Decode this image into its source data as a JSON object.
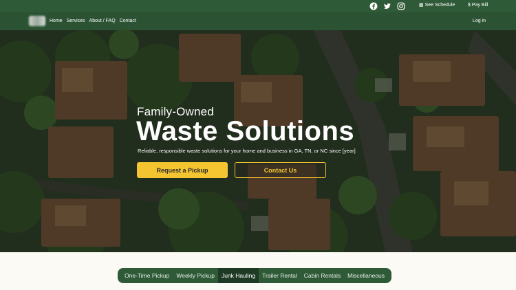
{
  "topbar": {
    "social": [
      "facebook-icon",
      "twitter-icon",
      "instagram-icon"
    ],
    "see_schedule": "See Schedule",
    "pay_bill": "Pay Bill"
  },
  "nav": {
    "items": [
      "Home",
      "Services",
      "About / FAQ",
      "Contact"
    ],
    "login": "Log in"
  },
  "hero": {
    "kicker": "Family-Owned",
    "headline": "Waste Solutions",
    "tagline": "Reliable, responsible waste solutions for your home and business in GA, TN, or NC since [year]",
    "primary_button": "Request a Pickup",
    "secondary_button": "Contact Us"
  },
  "service_tabs": {
    "items": [
      "One-Time Pickup",
      "Weekly Pickup",
      "Junk Hauling",
      "Trailer Rental",
      "Cabin Rentals",
      "Miscellaneous"
    ],
    "active": "Junk Hauling"
  },
  "colors": {
    "brand_green": "#2f5a37",
    "accent_yellow": "#f4c531"
  }
}
